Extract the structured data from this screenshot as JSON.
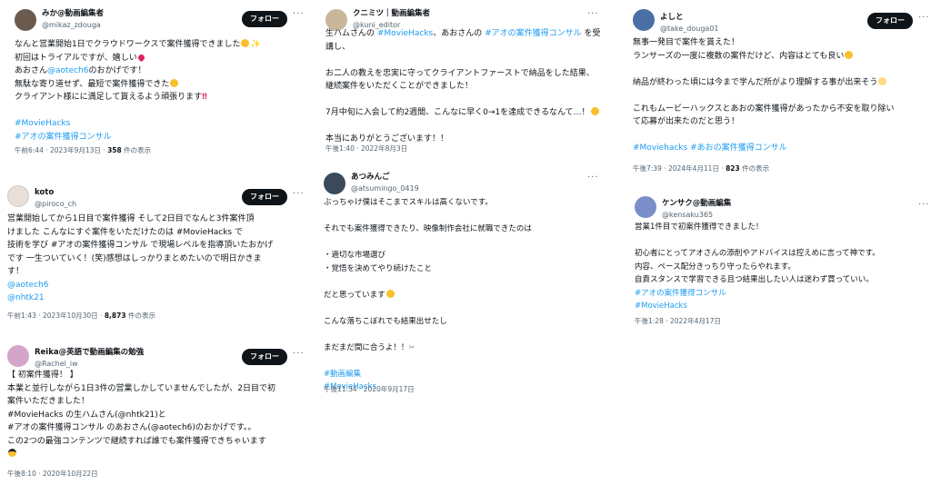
{
  "follow_label": "フォロー",
  "posts": [
    {
      "name": "みか@動画編集者",
      "handle": "@mikaz_zdouga",
      "avatar_color": "#6b5a4e",
      "lines": [
        "なんと営業開始1日でクラウドワークスで案件獲得できました",
        "初回はトライアルですが、嬉しい",
        "あおさん",
        "無駄な寄り道せず、最短で案件獲得できた",
        "クライアント様にに満足して貰えるよう頑張ります",
        "",
        "#MovieHacks",
        "#アオの案件獲得コンサル"
      ],
      "mention": "@aotech6",
      "mention_suffix": "のおかげです！",
      "time": "午前6:44 · 2023年9月13日 · ",
      "views": "358",
      "views_suffix": " 件の表示"
    },
    {
      "name": "クニミツ｜動画編集者",
      "handle": "@kuni_editor",
      "avatar_color": "#c9b79c",
      "line1_a": "生ハムさんの ",
      "line1_tag1": "#MovieHacks",
      "line1_b": "、あおさんの ",
      "line1_tag2": "#アオの案件獲得コンサル",
      "line1_c": " を受",
      "lines": [
        "講し、",
        "",
        "お二人の教えを忠実に守ってクライアントファーストで納品をした結果、",
        "継続案件をいただくことができました！",
        "",
        "7月中旬に入会して約2週間、こんなに早く0→1を達成できるなんて…！",
        "",
        "本当にありがとうございます！！"
      ],
      "time": "午後1:40 · 2022年8月3日"
    },
    {
      "name": "よしと",
      "handle": "@take_douga01",
      "avatar_color": "#4a6fa5",
      "lines": [
        "無事一発目で案件を貰えた！",
        "ランサーズの一度に複数の案件だけど、内容はとても良い",
        "",
        "納品が終わった頃には今まで学んだ所がより理解する事が出来そう",
        "",
        "これもムービーハックスとあおの案件獲得があったから不安を取り除い",
        "て応募が出来たのだと思う！",
        "",
        "#Moviehacks #あおの案件獲得コンサル"
      ],
      "time": "午後7:39 · 2024年4月11日 · ",
      "views": "823",
      "views_suffix": " 件の表示"
    },
    {
      "name": "koto",
      "handle": "@piroco_ch",
      "avatar_color": "#e8e0d8",
      "lines": [
        "営業開始してから1日目で案件獲得 そして2日目でなんと3件案件頂",
        "けました こんなにすぐ案件をいただけたのは #MovieHacks で",
        "技術を学び #アオの案件獲得コンサル で現場レベルを指導頂いたおかげ",
        "です 一生ついていく！(笑)感想はしっかりまとめたいので明日かきま",
        "す！",
        "@aotech6",
        "@nhtk21"
      ],
      "time": "午前1:43 · 2023年10月30日 · ",
      "views": "8,873",
      "views_suffix": " 件の表示"
    },
    {
      "name": "あつみんご",
      "handle": "@atsumingo_0419",
      "avatar_color": "#3a4a5a",
      "lines": [
        "ぶっちゃけ僕はそこまでスキルは高くないです。",
        "",
        "それでも案件獲得できたり、映像制作会社に就職できたのは",
        "",
        "・適切な市場選び",
        "・覚悟を決めてやり続けたこと",
        "",
        "だと思っています",
        "",
        "こんな落ちこぼれでも結果出せたし",
        "",
        "まだまだ間に合うよ！！",
        "",
        "#動画編集",
        "#MovieHacks"
      ],
      "time": "午後11:34 · 2020年9月17日"
    },
    {
      "name": "ケンサク@動画編集",
      "handle": "@kensaku365",
      "avatar_color": "#7a8fc9",
      "lines": [
        "営業1件目で初案件獲得できました！",
        "",
        "初心者にとってアオさんの添削やアドバイスは控えめに言って神です。",
        "内容、ペース配分きっちり守ったらやれます。",
        "自責スタンスで学習できる且つ結果出したい人は迷わず買っていい。",
        "#アオの案件獲得コンサル",
        "#MovieHacks"
      ],
      "time": "午後1:28 · 2022年4月17日"
    },
    {
      "name": "Reika@英語で動画編集の勉強",
      "handle": "@Rachel_iw",
      "avatar_color": "#d4a5c8",
      "lines": [
        "【 初案件獲得！ 】",
        "本業と並行しながら1日3件の営業しかしていませんでしたが、2日目で初",
        "案件いただきました！",
        "#MovieHacks の生ハムさん(@nhtk21)と",
        "#アオの案件獲得コンサル のあおさん(@aotech6)のおかげです。。",
        "この2つの最強コンテンツで継続すれば誰でも案件獲得できちゃいます"
      ],
      "time": "午後8:10 · 2020年10月22日"
    }
  ],
  "colors": {
    "link": "#1d9bf0",
    "text": "#0f1419",
    "muted": "#536471",
    "follow_bg": "#0f1419"
  }
}
